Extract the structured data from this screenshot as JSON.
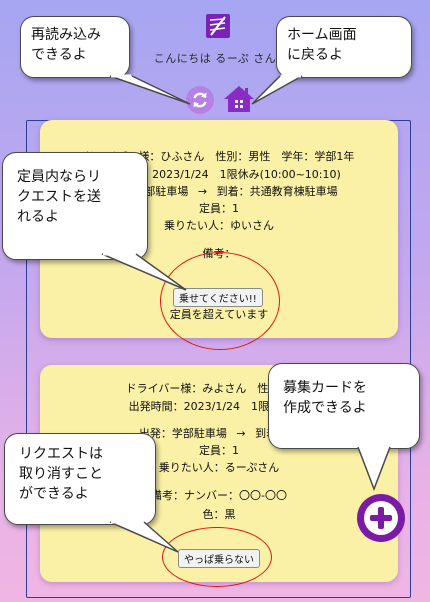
{
  "header": {
    "greeting": "こんにちは るーぷ さん"
  },
  "cards": [
    {
      "driver_line": "ドライバー様：ひふさん　性別：男性　学年：学部1年",
      "departure_time": "出発時間：2023/1/24　1限休み(10:00~10:10)",
      "route": {
        "from": "出発：学部駐車場",
        "arrow": "→",
        "to": "到着：共通教育棟駐車場"
      },
      "capacity": "定員：1",
      "riders": "乗りたい人：ゆいさん",
      "notes": "備考：",
      "action_label": "乗せてください!!",
      "status": "定員を超えています"
    },
    {
      "driver_line": "ドライバー様：みよさん　性別：男性",
      "departure_time": "出発時間：2023/1/24　1限休み(10",
      "route": {
        "from": "出発：学部駐車場",
        "arrow": "→",
        "to": "到着：ク"
      },
      "capacity": "定員：1",
      "riders": "乗りたい人：るーぷさん",
      "notes": "備考：ナンバー：〇〇-〇〇",
      "color": "色：黒",
      "action_label": "やっぱ乗らない"
    }
  ],
  "bubbles": {
    "reload": "再読み込み\nできるよ",
    "home": "ホーム画面\nに戻るよ",
    "request": "定員内ならリ\nクエストを送\nれるよ",
    "create": "募集カードを\n作成できるよ",
    "cancel": "リクエストは\n取り消すこと\nができるよ"
  },
  "colors": {
    "card_bg": "#faf0a6",
    "accent_purple": "#7b1aa4",
    "highlight_red": "#e01818"
  }
}
